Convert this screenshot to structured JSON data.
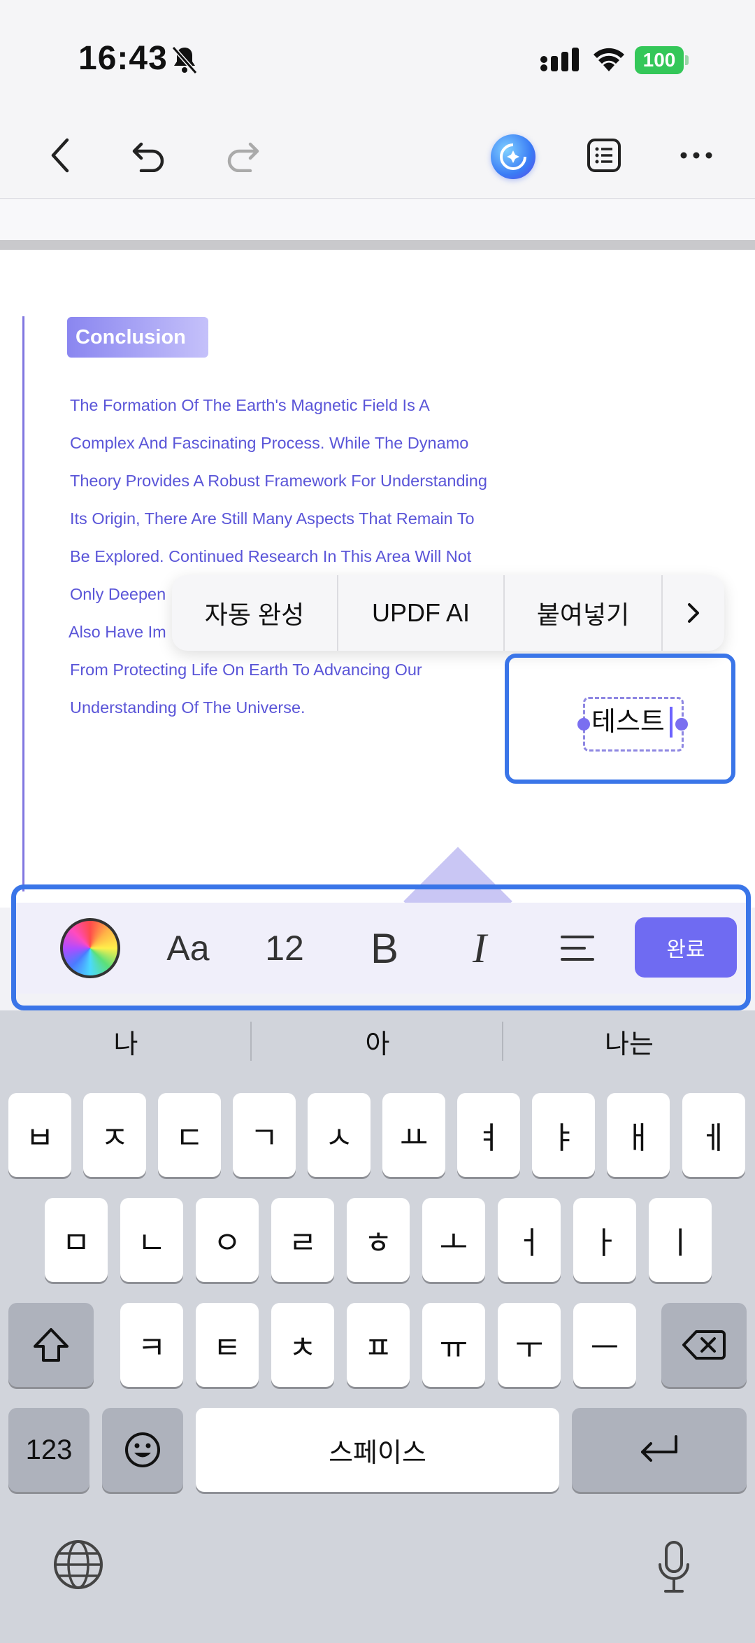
{
  "status_bar": {
    "time": "16:43",
    "battery": "100"
  },
  "toolbar": {
    "back_icon": "chevron-left-icon",
    "undo_icon": "undo-icon",
    "redo_icon": "redo-icon",
    "ai_icon": "ai-assistant-icon",
    "outline_icon": "list-icon",
    "more_icon": "more-icon"
  },
  "document": {
    "heading": "Conclusion",
    "lines": [
      "The Formation Of The Earth's Magnetic Field Is A",
      "Complex And Fascinating Process. While The Dynamo",
      "Theory Provides A Robust Framework For Understanding",
      "Its Origin, There Are Still Many Aspects That Remain To",
      "Be Explored. Continued Research In This Area Will Not",
      "Only Deepen",
      "Also Have Im",
      "From Protecting Life On Earth To Advancing Our",
      "Understanding Of The Universe."
    ],
    "accent_color": "#5a55d8"
  },
  "context_menu": {
    "items": [
      "자동 완성",
      "UPDF AI",
      "붙여넣기"
    ],
    "more_icon": "chevron-right-icon"
  },
  "text_box": {
    "value": "테스트"
  },
  "format_bar": {
    "font_label": "Aa",
    "font_size": "12",
    "bold": "B",
    "italic": "I",
    "done_label": "완료",
    "accent_color": "#6f6bf2"
  },
  "keyboard": {
    "suggestions": [
      "나",
      "아",
      "나는"
    ],
    "row1": [
      "ㅂ",
      "ㅈ",
      "ㄷ",
      "ㄱ",
      "ㅅ",
      "ㅛ",
      "ㅕ",
      "ㅑ",
      "ㅐ",
      "ㅔ"
    ],
    "row2": [
      "ㅁ",
      "ㄴ",
      "ㅇ",
      "ㄹ",
      "ㅎ",
      "ㅗ",
      "ㅓ",
      "ㅏ",
      "ㅣ"
    ],
    "row3": [
      "ㅋ",
      "ㅌ",
      "ㅊ",
      "ㅍ",
      "ㅠ",
      "ㅜ",
      "ㅡ"
    ],
    "numbers_label": "123",
    "space_label": "스페이스"
  }
}
